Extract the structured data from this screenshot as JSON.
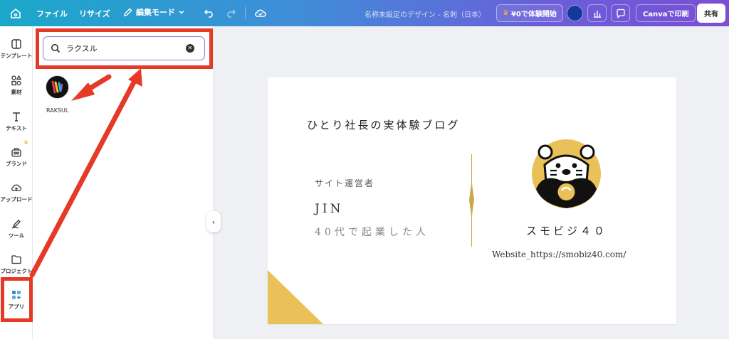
{
  "topbar": {
    "file": "ファイル",
    "resize": "リサイズ",
    "edit_mode": "編集モード",
    "doc_title": "名称未設定のデザイン - 名刺（日本）",
    "trial": "¥0で体験開始",
    "print": "Canvaで印刷",
    "share": "共有"
  },
  "rail": {
    "items": [
      {
        "label": "テンプレート",
        "icon": "template-icon"
      },
      {
        "label": "素材",
        "icon": "elements-icon"
      },
      {
        "label": "テキスト",
        "icon": "text-icon"
      },
      {
        "label": "ブランド",
        "icon": "brand-icon"
      },
      {
        "label": "アップロード",
        "icon": "upload-icon"
      },
      {
        "label": "ツール",
        "icon": "tools-icon"
      },
      {
        "label": "プロジェクト",
        "icon": "folder-icon"
      },
      {
        "label": "アプリ",
        "icon": "apps-icon"
      }
    ]
  },
  "panel": {
    "search_value": "ラクスル",
    "app_label": "RAKSUL"
  },
  "card": {
    "title": "ひとり社長の実体験ブログ",
    "role": "サイト運営者",
    "name": "JIN",
    "tagline": "40代で起業した人",
    "brand": "スモビジ４０",
    "url": "Website_https://smobiz40.com/"
  },
  "colors": {
    "highlight": "#e53a28",
    "accent_gold": "#e9c158",
    "trial_crown": "#f0b429"
  }
}
